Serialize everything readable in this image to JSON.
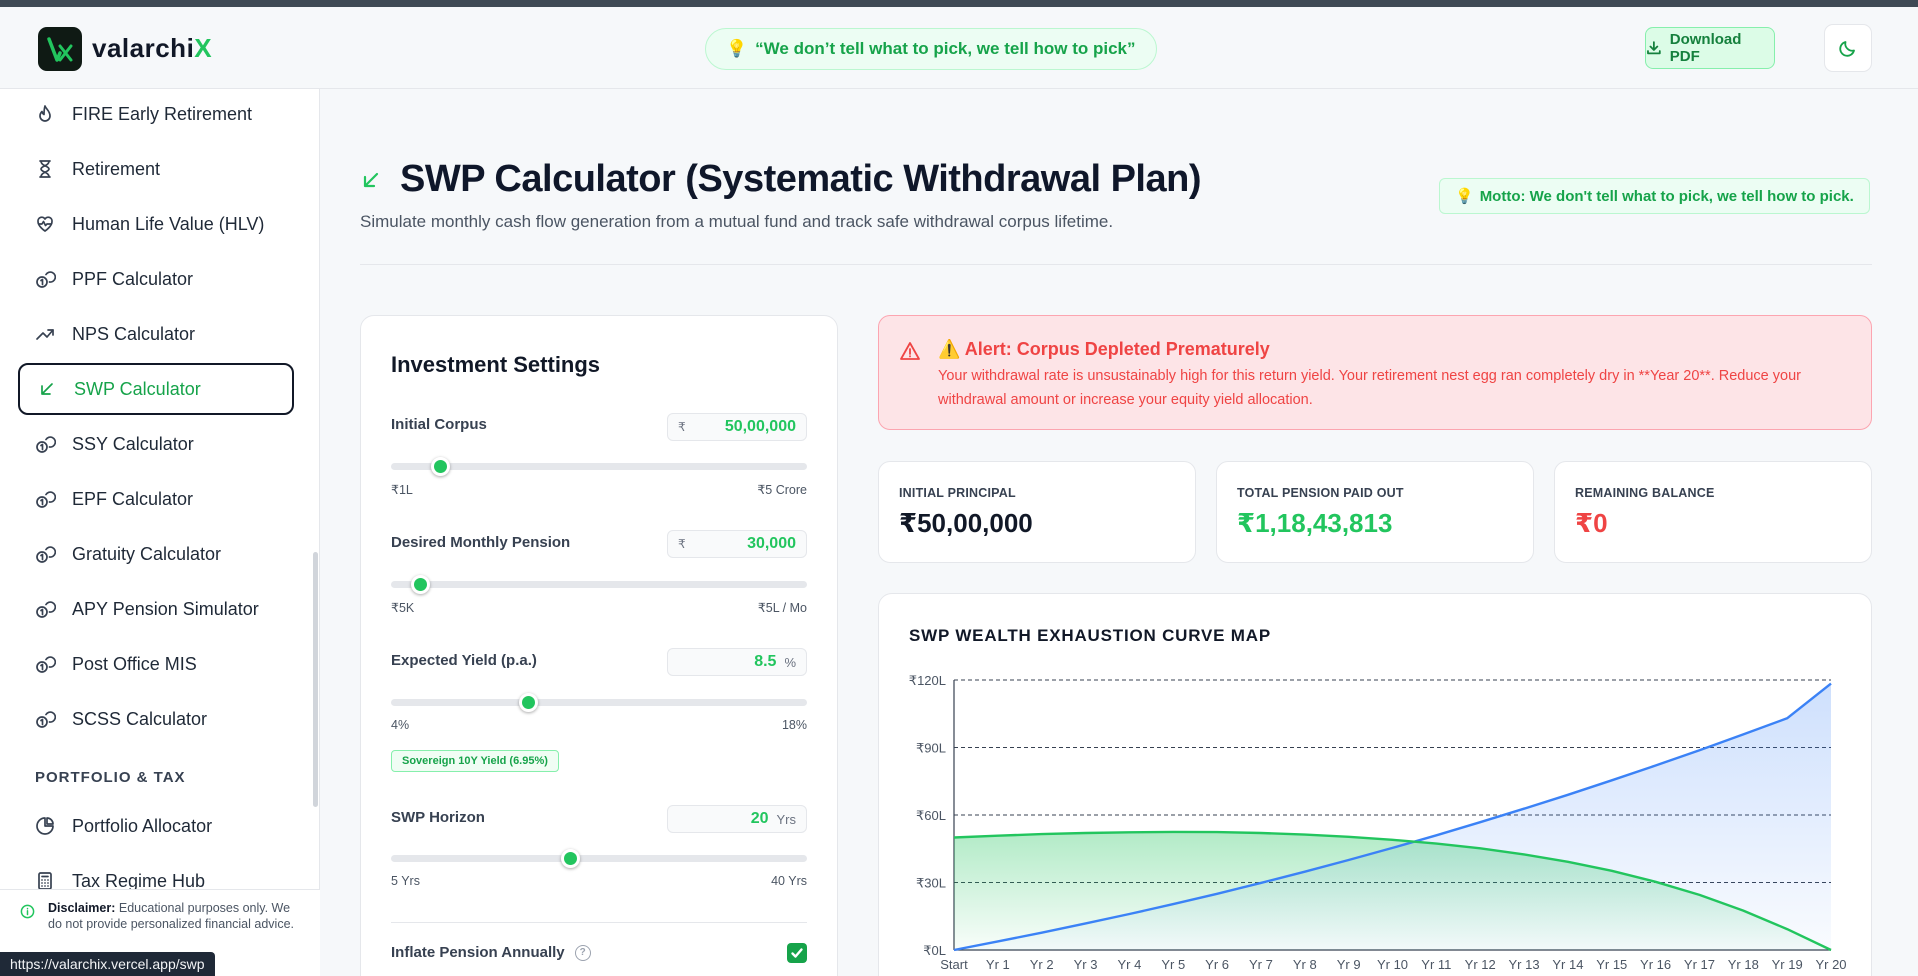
{
  "brand": {
    "name_main": "valarchi",
    "name_accent": "X"
  },
  "header": {
    "quote": "“We don’t tell what to pick, we tell how to pick”",
    "download_label": "Download PDF"
  },
  "sidebar": {
    "items": [
      {
        "label": "FIRE Early Retirement",
        "icon": "flame-icon"
      },
      {
        "label": "Retirement",
        "icon": "hourglass-icon"
      },
      {
        "label": "Human Life Value (HLV)",
        "icon": "heart-pulse-icon"
      },
      {
        "label": "PPF Calculator",
        "icon": "coins-icon"
      },
      {
        "label": "NPS Calculator",
        "icon": "trending-up-icon"
      },
      {
        "label": "SWP Calculator",
        "icon": "arrow-down-left-icon",
        "active": true
      },
      {
        "label": "SSY Calculator",
        "icon": "coins-icon"
      },
      {
        "label": "EPF Calculator",
        "icon": "coins-icon"
      },
      {
        "label": "Gratuity Calculator",
        "icon": "coins-icon"
      },
      {
        "label": "APY Pension Simulator",
        "icon": "coins-icon"
      },
      {
        "label": "Post Office MIS",
        "icon": "coins-icon"
      },
      {
        "label": "SCSS Calculator",
        "icon": "coins-icon"
      }
    ],
    "section_title": "PORTFOLIO & TAX",
    "section_items": [
      {
        "label": "Portfolio Allocator",
        "icon": "pie-chart-icon"
      },
      {
        "label": "Tax Regime Hub",
        "icon": "calculator-icon"
      }
    ],
    "disclaimer_bold": "Disclaimer:",
    "disclaimer_text": " Educational purposes only. We do not provide personalized financial advice."
  },
  "status_url": "https://valarchix.vercel.app/swp",
  "page": {
    "title": "SWP Calculator (Systematic Withdrawal Plan)",
    "subtitle": "Simulate monthly cash flow generation from a mutual fund and track safe withdrawal corpus lifetime.",
    "motto": "Motto: We don't tell what to pick, we tell how to pick."
  },
  "settings": {
    "title": "Investment Settings",
    "corpus": {
      "label": "Initial Corpus",
      "prefix": "₹",
      "value": "50,00,000",
      "min": "₹1L",
      "max": "₹5 Crore",
      "position": 0.118
    },
    "pension": {
      "label": "Desired Monthly Pension",
      "prefix": "₹",
      "value": "30,000",
      "min": "₹5K",
      "max": "₹5L / Mo",
      "position": 0.07
    },
    "yield": {
      "label": "Expected Yield (p.a.)",
      "value": "8.5",
      "suffix": "%",
      "min": "4%",
      "max": "18%",
      "position": 0.33,
      "badge": "Sovereign 10Y Yield (6.95%)"
    },
    "horizon": {
      "label": "SWP Horizon",
      "value": "20",
      "suffix": "Yrs",
      "min": "5 Yrs",
      "max": "40 Yrs",
      "position": 0.43
    },
    "inflate_label": "Inflate Pension Annually",
    "inflate_checked": true
  },
  "alert": {
    "title": "⚠️ Alert: Corpus Depleted Prematurely",
    "text": "Your withdrawal rate is unsustainably high for this return yield. Your retirement nest egg ran completely dry in **Year 20**. Reduce your withdrawal amount or increase your equity yield allocation."
  },
  "metrics": [
    {
      "label": "INITIAL PRINCIPAL",
      "value": "₹50,00,000",
      "color": "#111827"
    },
    {
      "label": "TOTAL PENSION PAID OUT",
      "value": "₹1,18,43,813",
      "color": "#22c55e"
    },
    {
      "label": "REMAINING BALANCE",
      "value": "₹0",
      "color": "#ef4444"
    }
  ],
  "chart_data": {
    "type": "area",
    "title": "SWP WEALTH EXHAUSTION CURVE MAP",
    "categories": [
      "Start",
      "Yr 1",
      "Yr 2",
      "Yr 3",
      "Yr 4",
      "Yr 5",
      "Yr 6",
      "Yr 7",
      "Yr 8",
      "Yr 9",
      "Yr 10",
      "Yr 11",
      "Yr 12",
      "Yr 13",
      "Yr 14",
      "Yr 15",
      "Yr 16",
      "Yr 17",
      "Yr 18",
      "Yr 19",
      "Yr 20"
    ],
    "y_ticks": [
      "₹0L",
      "₹30L",
      "₹60L",
      "₹90L",
      "₹120L"
    ],
    "ylim": [
      0,
      120
    ],
    "series": [
      {
        "color": "#22c55e",
        "fill": "#22c55e",
        "values": [
          50,
          50.8,
          51.5,
          52,
          52.3,
          52.5,
          52.4,
          52,
          51.3,
          50.3,
          49,
          47.3,
          45.2,
          42.5,
          39.2,
          35.2,
          30.3,
          24.5,
          17.5,
          9.3,
          0
        ]
      },
      {
        "color": "#3b82f6",
        "fill": "#3b82f6",
        "values": [
          0,
          3.8,
          7.7,
          11.8,
          16,
          20.4,
          25,
          29.8,
          34.8,
          40,
          45.4,
          51,
          56.8,
          62.8,
          69,
          75.4,
          82,
          88.8,
          95.8,
          103,
          118.4
        ]
      }
    ]
  }
}
